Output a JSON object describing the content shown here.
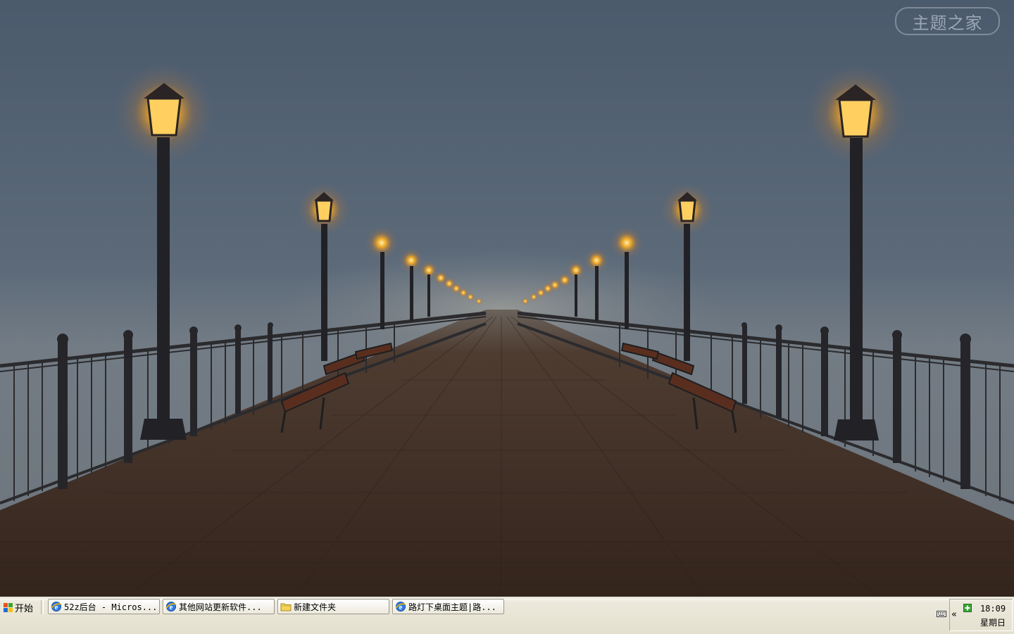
{
  "desktop": {
    "watermark_text": "主题之家",
    "colors": {
      "sky": "#56667a",
      "fog": "#7a828a",
      "deck": "#3e2c22",
      "lamp_glow": "#ffb020",
      "railing": "#2a2a2c"
    }
  },
  "taskbar": {
    "start_label": "开始",
    "tasks": [
      {
        "label": "52z后台 - Micros...",
        "icon": "ie-icon"
      },
      {
        "label": "其他网站更新软件...",
        "icon": "ie-icon"
      },
      {
        "label": "新建文件夹",
        "icon": "folder-icon"
      },
      {
        "label": "路灯下桌面主题|路...",
        "icon": "ie-icon"
      }
    ],
    "tray": {
      "expand_label": "«",
      "time": "18:09",
      "day": "星期日"
    }
  }
}
